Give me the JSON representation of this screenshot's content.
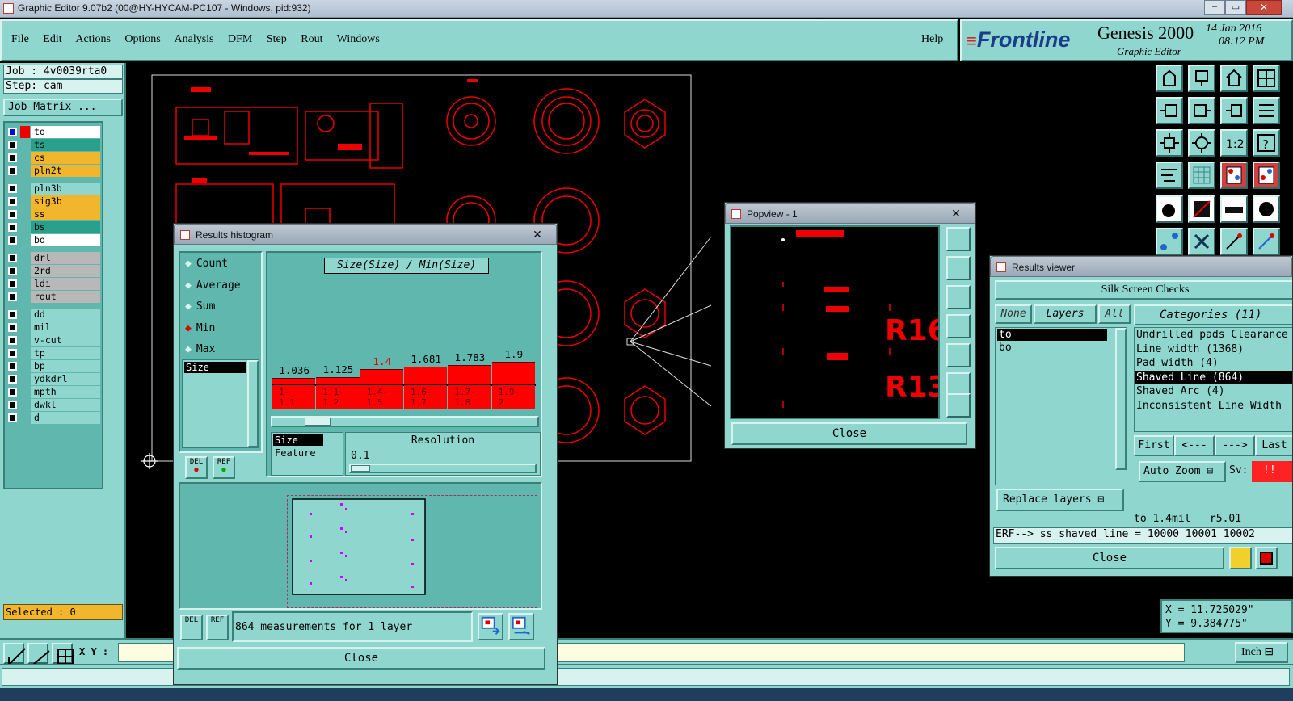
{
  "window": {
    "title": "Graphic Editor 9.07b2 (00@HY-HYCAM-PC107 - Windows, pid:932)"
  },
  "menu": {
    "items": [
      "File",
      "Edit",
      "Actions",
      "Options",
      "Analysis",
      "DFM",
      "Step",
      "Rout",
      "Windows"
    ],
    "help": "Help"
  },
  "brand": {
    "logo": "Frontline",
    "product": "Genesis 2000",
    "subtitle": "Graphic Editor",
    "date": "14 Jan 2016",
    "time": "08:12 PM"
  },
  "job": {
    "job_label": "Job : 4v0039rta0",
    "step_label": "Step: cam",
    "matrix_button": "Job Matrix ..."
  },
  "layers": [
    {
      "name": "to",
      "color": "#ffffff"
    },
    {
      "name": "ts",
      "color": "#28a08c"
    },
    {
      "name": "cs",
      "color": "#f2b62c"
    },
    {
      "name": "pln2t",
      "color": "#f2b62c"
    },
    {
      "name": "pln3b",
      "color": "#8fd6cf"
    },
    {
      "name": "sig3b",
      "color": "#f2b62c"
    },
    {
      "name": "ss",
      "color": "#f2b62c"
    },
    {
      "name": "bs",
      "color": "#28a08c"
    },
    {
      "name": "bo",
      "color": "#ffffff"
    },
    {
      "name": "drl",
      "color": "#b8b8b8"
    },
    {
      "name": "2rd",
      "color": "#b8b8b8"
    },
    {
      "name": "ldi",
      "color": "#b8b8b8"
    },
    {
      "name": "rout",
      "color": "#b8b8b8"
    },
    {
      "name": "dd",
      "color": "#8fd6cf"
    },
    {
      "name": "mil",
      "color": "#8fd6cf"
    },
    {
      "name": "v-cut",
      "color": "#8fd6cf"
    },
    {
      "name": "tp",
      "color": "#8fd6cf"
    },
    {
      "name": "bp",
      "color": "#8fd6cf"
    },
    {
      "name": "ydkdrl",
      "color": "#8fd6cf"
    },
    {
      "name": "mpth",
      "color": "#8fd6cf"
    },
    {
      "name": "dwkl",
      "color": "#8fd6cf"
    },
    {
      "name": "d",
      "color": "#8fd6cf"
    }
  ],
  "selected": "Selected : 0",
  "xy_label": "X Y :",
  "units": "Inch",
  "coords": {
    "x": "X = 11.725029\"",
    "y": "Y = 9.384775\""
  },
  "histogram": {
    "title": "Results histogram",
    "options": [
      "Count",
      "Average",
      "Sum",
      "Min",
      "Max"
    ],
    "selected_option": "Min",
    "list_item": "Size",
    "chart_title": "Size(Size) / Min(Size)",
    "bars": [
      {
        "val": "1.036",
        "range": "1-\n1.1",
        "h": 0.12
      },
      {
        "val": "1.125",
        "range": "1.1-\n1.2",
        "h": 0.14
      },
      {
        "val": "1.4",
        "range": "1.4-\n1.5",
        "h": 0.3,
        "hl": true
      },
      {
        "val": "1.681",
        "range": "1.6-\n1.7",
        "h": 0.35
      },
      {
        "val": "1.783",
        "range": "1.7-\n1.8",
        "h": 0.38
      },
      {
        "val": "1.9",
        "range": "1.9-\n2",
        "h": 0.45
      }
    ],
    "list2": [
      "Size",
      "Feature"
    ],
    "resolution_label": "Resolution",
    "resolution_value": "0.1",
    "del": "DEL",
    "ref": "REF",
    "status": "864 measurements for 1 layer",
    "close": "Close"
  },
  "popview": {
    "title": "Popview - 1",
    "label1": "R16",
    "label2": "R13",
    "close": "Close"
  },
  "results": {
    "title": "Results viewer",
    "header": "Silk Screen Checks",
    "tabs": [
      "None",
      "Layers",
      "All"
    ],
    "categories_label": "Categories (11)",
    "layers": [
      "to",
      "bo"
    ],
    "categories": [
      "Undrilled pads Clearance",
      "Line width (1368)",
      "Pad width (4)",
      "Shaved Line (864)",
      "Shaved Arc (4)",
      "Inconsistent Line Width"
    ],
    "nav": [
      "First",
      "<---",
      "--->",
      "Last"
    ],
    "auto_zoom": "Auto Zoom",
    "sv": "Sv:",
    "sv_value": "!!",
    "replace": "Replace layers",
    "info": "to 1.4mil   r5.01",
    "erf": "ERF--> ss_shaved_line = 10000 10001 10002",
    "close": "Close"
  }
}
